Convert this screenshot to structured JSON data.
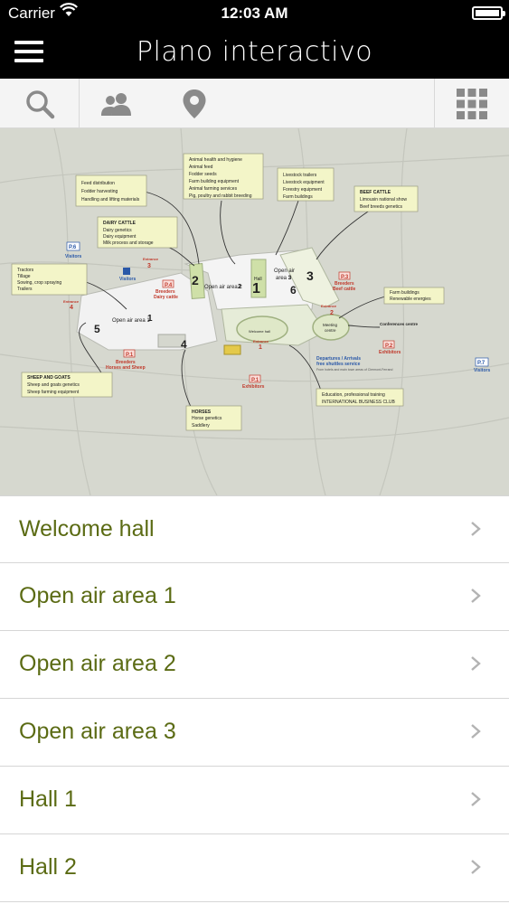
{
  "status_bar": {
    "carrier": "Carrier",
    "time": "12:03 AM"
  },
  "nav": {
    "title": "Plano interactivo"
  },
  "toolbar": {
    "icons": [
      "search-icon",
      "users-icon",
      "location-pin-icon",
      "grid-icon"
    ]
  },
  "colors": {
    "accent_text": "#5b6b14",
    "nav_bg": "#000000",
    "map_bg": "#d6d8cf",
    "map_label_bg": "#f3f5c8",
    "hall_fill": "#f2f2f2"
  },
  "map": {
    "labels": {
      "hall": "Hall",
      "hall1_num": "1",
      "hall2_num": "2",
      "area1": "Open air area 1",
      "area2": "Open air area 2",
      "area3_a": "Open air",
      "area3_b": "area 3",
      "num3": "3",
      "num4": "4",
      "num5": "5",
      "num6": "6",
      "p6": "P.6",
      "p6_sub": "Visitors",
      "p7": "P.7",
      "p7_sub": "Visitors",
      "p_visitors": "Visitors",
      "p1": "P.1",
      "p1_sub": "Breeders",
      "p1_sub2": "Horses and Sheep",
      "p2": "P.2",
      "p2_sub": "Exhibitors",
      "p3": "P.3",
      "p3_sub": "Breeders",
      "p3_sub2": "Beef cattle",
      "p4": "P.4",
      "p4_sub": "Breeders",
      "p4_sub2": "Dairy cattle",
      "pe": "P.1",
      "pe_sub": "Exhibitors",
      "entrance1": "Entrance",
      "entrance2": "Entrance",
      "entrance3": "Entrance",
      "entrance4": "Entrance",
      "meeting": "Meeting",
      "meeting2": "centre",
      "conferences": "Conferences centre",
      "welcome": "Welcome hall",
      "departures": "Departures / Arrivals",
      "departures2": "free shuttles service",
      "departures3": "From hotels and main town areas of Clermont-Ferrand"
    },
    "boxes": {
      "feed": [
        "Feed distribution",
        "Fodder harvesting",
        "Handling and lifting materials"
      ],
      "animal": [
        "Animal health and hygiene",
        "Animal feed",
        "Fodder seeds",
        "Farm building equipment",
        "Animal farming services",
        "Pig, poultry and rabbit breeding"
      ],
      "livestock": [
        "Livestock trailers",
        "Livestock equipment",
        "Forestry equipment",
        "Farm buildings"
      ],
      "beef_title": "BEEF CATTLE",
      "beef": [
        "Limousin national show",
        "Beef breeds genetics"
      ],
      "dairy_title": "DAIRY CATTLE",
      "dairy": [
        "Dairy genetics",
        "Dairy equipment",
        "Milk process and storage"
      ],
      "tractors": [
        "Tractors",
        "Tillage",
        "Sowing, crop spraying",
        "Trailers"
      ],
      "farm": [
        "Farm buildings",
        "Renewable energies"
      ],
      "sheep_title": "SHEEP AND GOATS",
      "sheep": [
        "Sheep and goats genetics",
        "Sheep farming equipment"
      ],
      "horses_title": "HORSES",
      "horses": [
        "Horse genetics",
        "Saddlery"
      ],
      "business": [
        "Education, professional training",
        "INTERNATIONAL BUSINESS CLUB"
      ]
    }
  },
  "list": {
    "items": [
      {
        "label": "Welcome hall"
      },
      {
        "label": "Open air area 1"
      },
      {
        "label": "Open air area 2"
      },
      {
        "label": "Open air area 3"
      },
      {
        "label": "Hall 1"
      },
      {
        "label": "Hall 2"
      }
    ]
  }
}
